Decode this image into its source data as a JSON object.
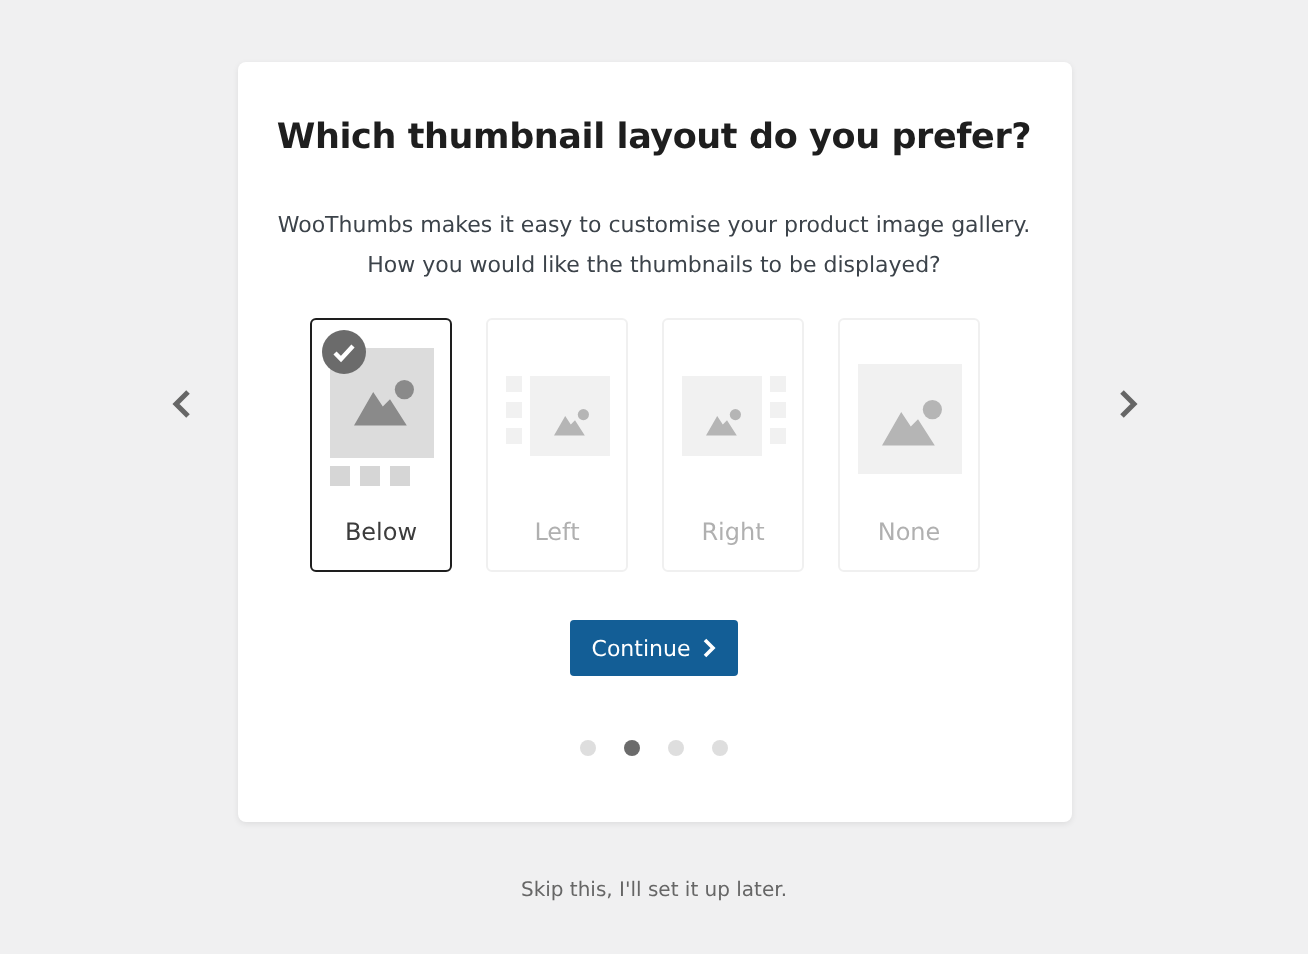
{
  "title": "Which thumbnail layout do you prefer?",
  "description": "WooThumbs makes it easy to customise your product image gallery. How you would like the thumbnails to be displayed?",
  "options": [
    {
      "kind": "below",
      "label": "Below",
      "selected": true
    },
    {
      "kind": "left",
      "label": "Left",
      "selected": false
    },
    {
      "kind": "right",
      "label": "Right",
      "selected": false
    },
    {
      "kind": "none",
      "label": "None",
      "selected": false
    }
  ],
  "continue_button": {
    "label": "Continue"
  },
  "steps": [
    {
      "selected": false
    },
    {
      "selected": true
    },
    {
      "selected": false
    },
    {
      "selected": false
    }
  ],
  "skip_link": "Skip this, I'll set it up later."
}
